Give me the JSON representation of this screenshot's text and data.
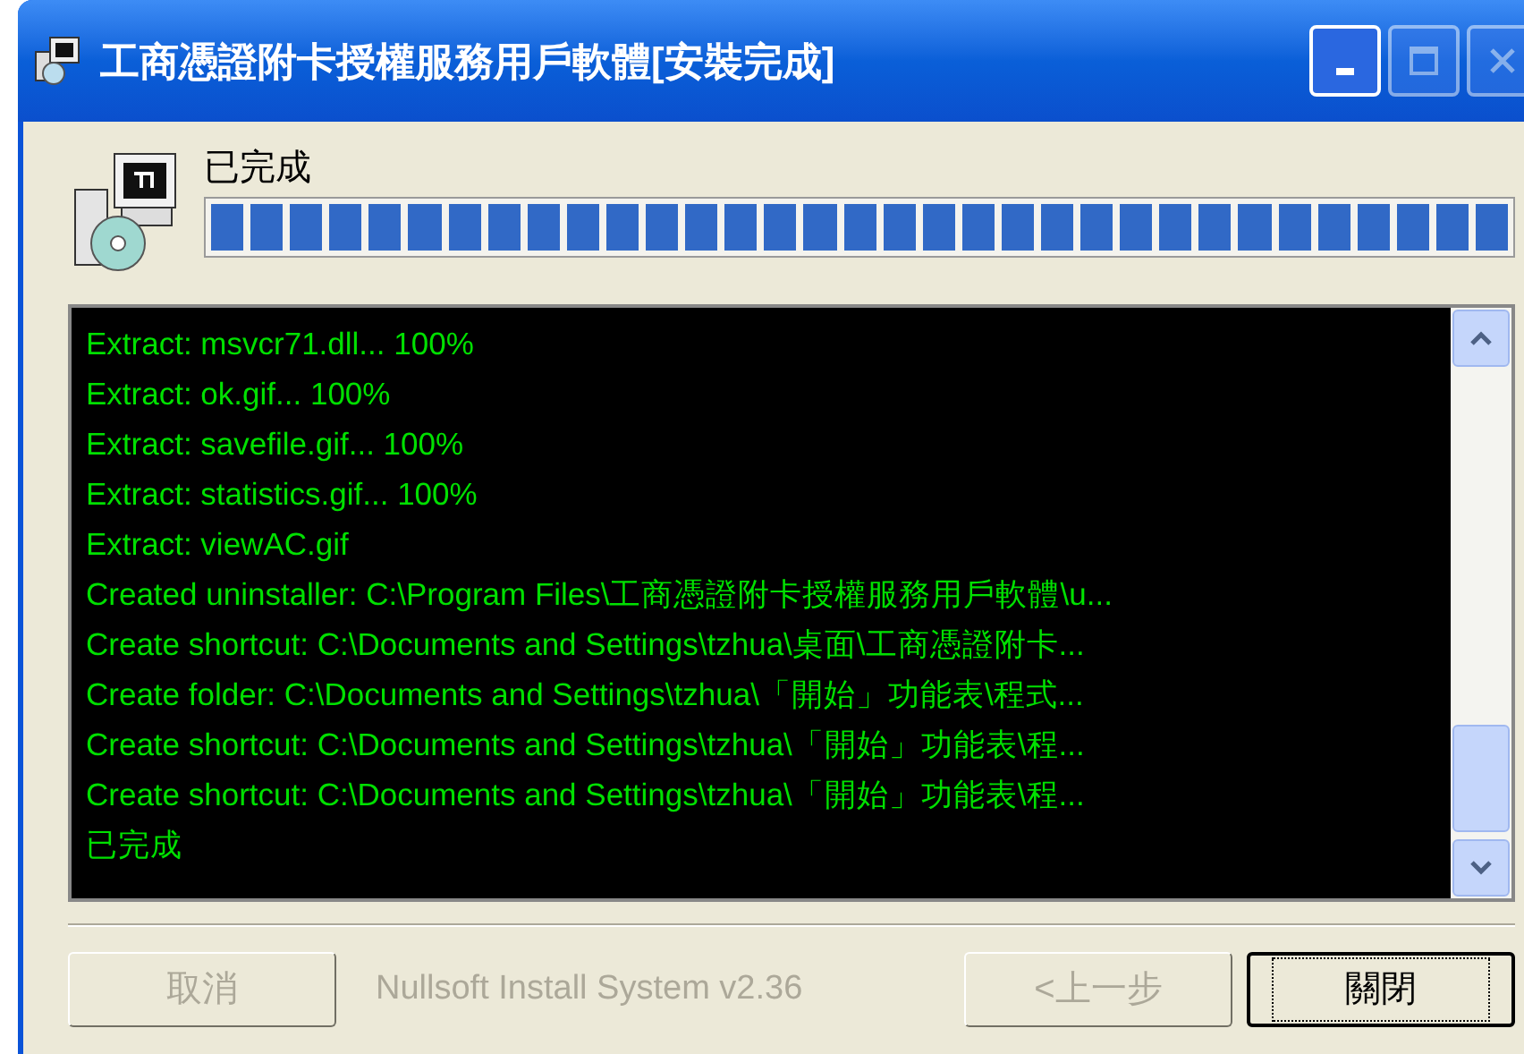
{
  "window": {
    "title": "工商憑證附卡授權服務用戶軟體[安裝完成]"
  },
  "title_buttons": [
    {
      "kind": "minimize",
      "disabled": false
    },
    {
      "kind": "maximize",
      "disabled": true
    },
    {
      "kind": "close",
      "disabled": true
    }
  ],
  "status": "已完成",
  "progress": {
    "level": 1
  },
  "log": {
    "lines": [
      "Extract: msvcr71.dll... 100%",
      "Extract: ok.gif... 100%",
      "Extract: savefile.gif... 100%",
      "Extract: statistics.gif... 100%",
      "Extract: viewAC.gif",
      "Created uninstaller: C:\\Program Files\\工商憑證附卡授權服務用戶軟體\\u...",
      "Create shortcut: C:\\Documents and Settings\\tzhua\\桌面\\工商憑證附卡...",
      "Create folder: C:\\Documents and Settings\\tzhua\\「開始」功能表\\程式...",
      "Create shortcut: C:\\Documents and Settings\\tzhua\\「開始」功能表\\程...",
      "Create shortcut: C:\\Documents and Settings\\tzhua\\「開始」功能表\\程...",
      "已完成"
    ]
  },
  "buttons": [
    {
      "label": "取消",
      "disabled": true,
      "default": false
    },
    {
      "label": "<上一步",
      "disabled": true,
      "default": false
    },
    {
      "label": "關閉",
      "disabled": false,
      "default": true
    }
  ],
  "branding": "Nullsoft Install System v2.36"
}
